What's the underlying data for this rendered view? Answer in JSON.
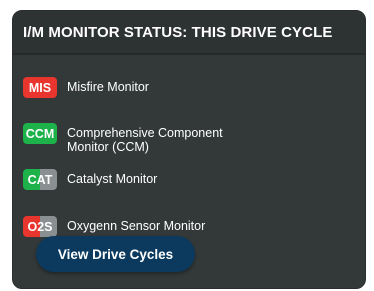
{
  "header": {
    "title": "I/M MONITOR STATUS: THIS DRIVE CYCLE"
  },
  "monitors": [
    {
      "badge": "MIS",
      "label": "Misfire Monitor",
      "badge_color": "#e8362f"
    },
    {
      "badge": "CCM",
      "label": "Comprehensive Component Monitor (CCM)",
      "badge_color": "#1db24a"
    },
    {
      "badge": "CAT",
      "label": "Catalyst Monitor",
      "badge_color": "#1db24a",
      "badge_color_secondary": "#8a8f91"
    },
    {
      "badge": "O2S",
      "label": "Oxygenn Sensor Monitor",
      "badge_color": "#e8362f",
      "badge_color_secondary": "#8a8f91"
    }
  ],
  "button": {
    "label": "View Drive Cycles"
  },
  "colors": {
    "card_bg": "#333839",
    "button_bg": "#0b3a5e",
    "accent_red": "#e8362f",
    "accent_green": "#1db24a"
  }
}
